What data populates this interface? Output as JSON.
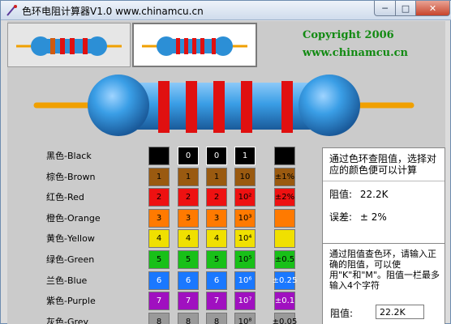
{
  "window": {
    "title": "色环电阻计算器V1.0  www.chinamcu.cn",
    "minimize_label": "─",
    "maximize_label": "□",
    "close_label": "✕"
  },
  "header": {
    "copyright_line1": "Copyright 2006",
    "copyright_line2": "www.chinamcu.cn"
  },
  "resistor_tabs": [
    {
      "label": "4-band resistor",
      "selected": false
    },
    {
      "label": "5-band resistor",
      "selected": true
    }
  ],
  "big_resistor": {
    "body_color": "#3a9ee6",
    "band_color": "#e01010",
    "lead_color": "#f0a000"
  },
  "color_names": [
    "黑色-Black",
    "棕色-Brown",
    "红色-Red",
    "橙色-Orange",
    "黄色-Yellow",
    "绿色-Green",
    "兰色-Blue",
    "紫色-Purple",
    "灰色-Grey"
  ],
  "colors": [
    "#000000",
    "#9a5a10",
    "#ee1111",
    "#ff7a00",
    "#f0e000",
    "#18c018",
    "#1a78ff",
    "#a010c0",
    "#9a9a9a"
  ],
  "digit_columns": {
    "col1": [
      "",
      "1",
      "2",
      "3",
      "4",
      "5",
      "6",
      "7",
      "8"
    ],
    "col2": [
      "0",
      "1",
      "2",
      "3",
      "4",
      "5",
      "6",
      "7",
      "8"
    ],
    "col3": [
      "0",
      "1",
      "2",
      "3",
      "4",
      "5",
      "6",
      "7",
      "8"
    ]
  },
  "multiplier_column": [
    "1",
    "10",
    "10²",
    "10³",
    "10⁴",
    "10⁵",
    "10⁶",
    "10⁷",
    "10⁸"
  ],
  "tolerance_column": [
    "",
    "±1%",
    "±2%",
    "",
    "",
    "±0.5",
    "±0.25",
    "±0.1",
    "±0.05"
  ],
  "panel_lookup": {
    "description": "通过色环查阻值，选择对应的颜色便可以计算",
    "resistance_label": "阻值:",
    "resistance_value": "22.2K",
    "tolerance_label": "误差:",
    "tolerance_value": "± 2%"
  },
  "panel_input": {
    "description": "通过阻值查色环，请输入正确的阻值，可以使用\"K\"和\"M\"。阻值一栏最多输入4个字符",
    "resistance_label": "阻值:",
    "resistance_value": "22.2K"
  }
}
